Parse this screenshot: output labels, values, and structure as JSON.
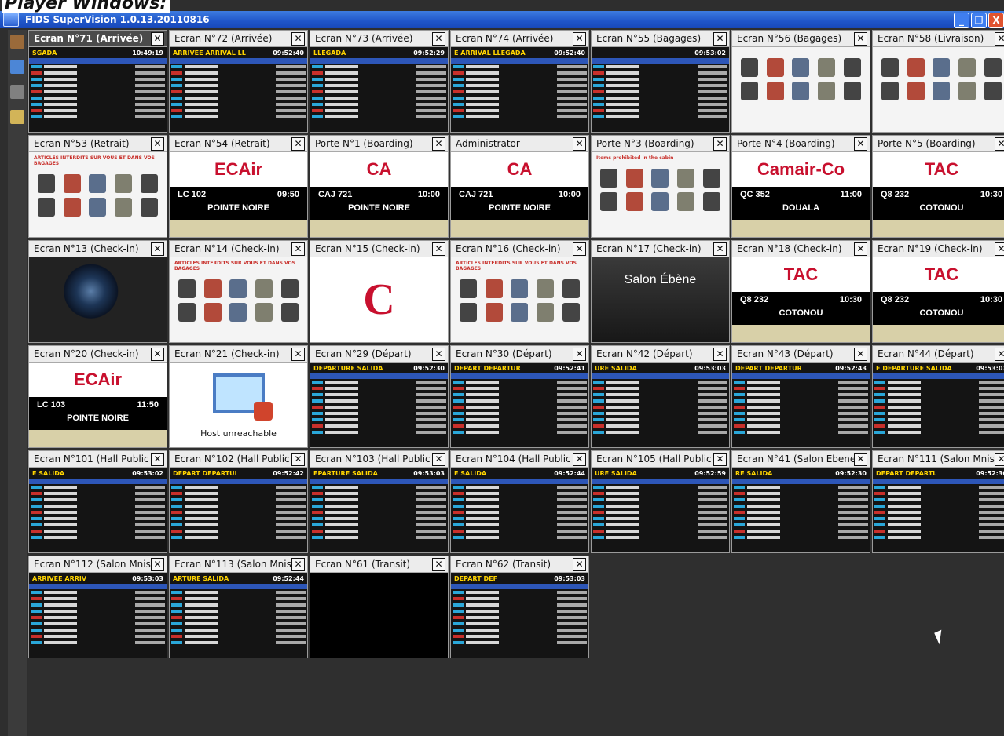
{
  "background_text": "Player Windows:",
  "window_title": "FIDS SuperVision 1.0.13.20110816",
  "window_buttons": [
    "_",
    "❐",
    "X"
  ],
  "tiles": [
    {
      "title": "Ecran N°71 (Arrivée)",
      "selected": true,
      "kind": "fids",
      "heading": "SGADA",
      "time": "10:49:19"
    },
    {
      "title": "Ecran N°72 (Arrivée)",
      "kind": "fids",
      "heading": "ARRIVEE ARRIVAL LL",
      "time": "09:52:40"
    },
    {
      "title": "Ecran N°73 (Arrivée)",
      "kind": "fids",
      "heading": "LLEGADA",
      "time": "09:52:29"
    },
    {
      "title": "Ecran N°74 (Arrivée)",
      "kind": "fids",
      "heading": "E ARRIVAL LLEGADA",
      "time": "09:52:40"
    },
    {
      "title": "Ecran N°55 (Bagages)",
      "kind": "fids",
      "heading": "",
      "time": "09:53:02"
    },
    {
      "title": "Ecran N°56 (Bagages)",
      "kind": "baggage",
      "notice": ""
    },
    {
      "title": "Ecran N°58 (Livraison)",
      "kind": "baggage",
      "notice": ""
    },
    {
      "title": "Ecran N°53 (Retrait)",
      "kind": "baggage",
      "notice": "ARTICLES INTERDITS SUR VOUS ET DANS VOS BAGAGES"
    },
    {
      "title": "Ecran N°54 (Retrait)",
      "kind": "board",
      "logo": "ECAir",
      "flight": "LC 102",
      "time": "09:50",
      "city": "POINTE NOIRE"
    },
    {
      "title": "Porte N°1 (Boarding)",
      "kind": "board",
      "logo": "CA",
      "flight": "CAJ 721",
      "time": "10:00",
      "city": "POINTE NOIRE"
    },
    {
      "title": "Administrator",
      "kind": "board",
      "logo": "CA",
      "flight": "CAJ 721",
      "time": "10:00",
      "city": "POINTE NOIRE"
    },
    {
      "title": "Porte N°3 (Boarding)",
      "kind": "baggage",
      "notice": "Items prohibited in the cabin"
    },
    {
      "title": "Porte N°4 (Boarding)",
      "kind": "board",
      "logo": "Camair-Co",
      "flight": "QC 352",
      "time": "11:00",
      "city": "DOUALA"
    },
    {
      "title": "Porte N°5 (Boarding)",
      "kind": "board",
      "logo": "TAC",
      "flight": "Q8 232",
      "time": "10:30",
      "city": "COTONOU"
    },
    {
      "title": "Ecran N°13 (Check-in)",
      "kind": "earth"
    },
    {
      "title": "Ecran N°14 (Check-in)",
      "kind": "baggage",
      "notice": "ARTICLES INTERDITS SUR VOUS ET DANS VOS BAGAGES"
    },
    {
      "title": "Ecran N°15 (Check-in)",
      "kind": "ca"
    },
    {
      "title": "Ecran N°16 (Check-in)",
      "kind": "baggage",
      "notice": "ARTICLES INTERDITS SUR VOUS ET DANS VOS BAGAGES"
    },
    {
      "title": "Ecran N°17 (Check-in)",
      "kind": "salon",
      "text": "Salon Ébène"
    },
    {
      "title": "Ecran N°18 (Check-in)",
      "kind": "board",
      "logo": "TAC",
      "flight": "Q8 232",
      "time": "10:30",
      "city": "COTONOU"
    },
    {
      "title": "Ecran N°19 (Check-in)",
      "kind": "board",
      "logo": "TAC",
      "flight": "Q8 232",
      "time": "10:30",
      "city": "COTONOU"
    },
    {
      "title": "Ecran N°20 (Check-in)",
      "kind": "board",
      "logo": "ECAir",
      "flight": "LC 103",
      "time": "11:50",
      "city": "POINTE NOIRE"
    },
    {
      "title": "Ecran N°21 (Check-in)",
      "kind": "host",
      "text": "Host unreachable"
    },
    {
      "title": "Ecran N°29 (Départ)",
      "kind": "fids",
      "heading": "DEPARTURE SALIDA",
      "time": "09:52:30"
    },
    {
      "title": "Ecran N°30 (Départ)",
      "kind": "fids",
      "heading": "DEPART DEPARTUR",
      "time": "09:52:41"
    },
    {
      "title": "Ecran N°42 (Départ)",
      "kind": "fids",
      "heading": "URE SALIDA",
      "time": "09:53:03"
    },
    {
      "title": "Ecran N°43 (Départ)",
      "kind": "fids",
      "heading": "DEPART DEPARTUR",
      "time": "09:52:43"
    },
    {
      "title": "Ecran N°44 (Départ)",
      "kind": "fids",
      "heading": "F DEPARTURE SALIDA",
      "time": "09:53:03"
    },
    {
      "title": "Ecran N°101 (Hall Public -",
      "kind": "fids",
      "heading": "E SALIDA",
      "time": "09:53:02"
    },
    {
      "title": "Ecran N°102 (Hall Public -",
      "kind": "fids",
      "heading": "DEPART DEPARTUI",
      "time": "09:52:42"
    },
    {
      "title": "Ecran N°103 (Hall Public -",
      "kind": "fids",
      "heading": "EPARTURE SALIDA",
      "time": "09:53:03"
    },
    {
      "title": "Ecran N°104 (Hall Public -",
      "kind": "fids",
      "heading": "E SALIDA",
      "time": "09:52:44"
    },
    {
      "title": "Ecran N°105 (Hall Public -",
      "kind": "fids",
      "heading": "URE SALIDA",
      "time": "09:52:59"
    },
    {
      "title": "Ecran N°41 (Salon Ebene)",
      "kind": "fids",
      "heading": "RE SALIDA",
      "time": "09:52:30"
    },
    {
      "title": "Ecran N°111 (Salon Mniste",
      "kind": "fids",
      "heading": "DEPART DEPARTL",
      "time": "09:52:30"
    },
    {
      "title": "Ecran N°112 (Salon Mniste",
      "kind": "fids",
      "heading": "ARRIVEE ARRIV",
      "time": "09:53:03"
    },
    {
      "title": "Ecran N°113 (Salon Mniste",
      "kind": "fids",
      "heading": "ARTURE SALIDA",
      "time": "09:52:44"
    },
    {
      "title": "Ecran N°61 (Transit)",
      "kind": "blank"
    },
    {
      "title": "Ecran N°62 (Transit)",
      "kind": "fids",
      "heading": "DEPART DEF",
      "time": "09:53:03"
    }
  ]
}
